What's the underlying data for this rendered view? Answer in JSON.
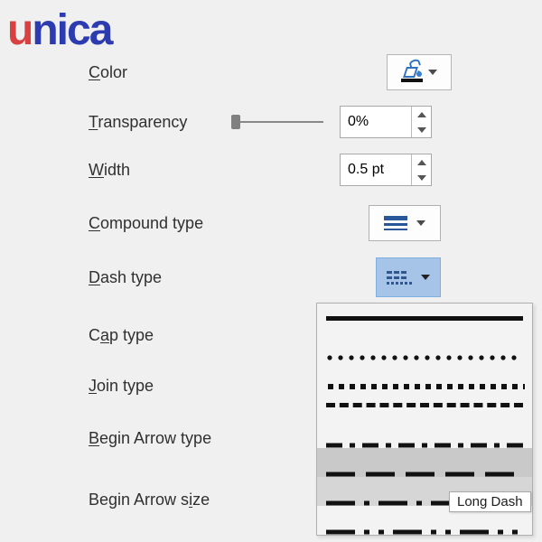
{
  "logo_letters": [
    "u",
    "n",
    "i",
    "c",
    "a"
  ],
  "labels": {
    "color": "Color",
    "transparency": "Transparency",
    "width": "Width",
    "compound": "Compound type",
    "dash": "Dash type",
    "cap": "Cap type",
    "join": "Join type",
    "begin_arrow_type": "Begin Arrow type",
    "begin_arrow_size": "Begin Arrow size"
  },
  "values": {
    "transparency": "0%",
    "width": "0.5 pt"
  },
  "dash_menu": {
    "items": [
      {
        "name": "Solid",
        "pattern": "solid",
        "selected": false,
        "hover": false
      },
      {
        "name": "Round Dot",
        "pattern": "round-dot",
        "selected": false,
        "hover": false
      },
      {
        "name": "Square Dot",
        "pattern": "square-dot",
        "selected": false,
        "hover": false
      },
      {
        "name": "Dash",
        "pattern": "dash",
        "selected": false,
        "hover": false
      },
      {
        "name": "Dash Dot",
        "pattern": "dash-dot",
        "selected": false,
        "hover": false
      },
      {
        "name": "Long Dash",
        "pattern": "long-dash",
        "selected": true,
        "hover": false
      },
      {
        "name": "Long Dash Dot",
        "pattern": "long-dash-dot",
        "selected": false,
        "hover": true
      },
      {
        "name": "Long Dash Dot Dot",
        "pattern": "long-dash-dot-dot",
        "selected": false,
        "hover": false
      }
    ],
    "tooltip": "Long Dash"
  }
}
